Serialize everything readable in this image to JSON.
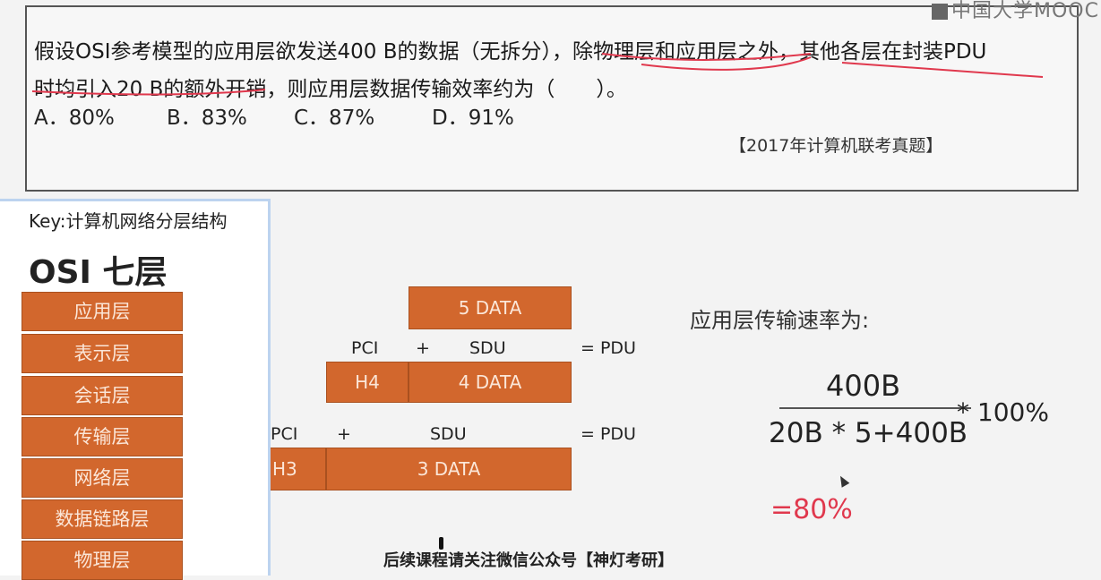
{
  "logo": {
    "text": "中国大学MOOC"
  },
  "question": {
    "line1": "假设OSI参考模型的应用层欲发送400 B的数据（无拆分），除物理层和应用层之外，其他各层在封装PDU",
    "line2": "时均引入20 B的额外开销，则应用层数据传输效率约为（　　）。",
    "options": [
      "A．80%",
      "B．83%",
      "C．87%",
      "D．91%"
    ],
    "source": "【2017年计算机联考真题】"
  },
  "sidebar": {
    "key_label": "Key:计算机网络分层结构",
    "title": "OSI 七层",
    "layers": [
      "应用层",
      "表示层",
      "会话层",
      "传输层",
      "网络层",
      "数据链路层",
      "物理层"
    ]
  },
  "diagram": {
    "row1_data": "5 DATA",
    "row2": {
      "pci": "PCI",
      "plus": "+",
      "sdu": "SDU",
      "eq": "= PDU",
      "header": "H4",
      "data": "4 DATA"
    },
    "row3": {
      "pci": "PCI",
      "plus": "+",
      "sdu": "SDU",
      "eq": "= PDU",
      "header": "H3",
      "data": "3 DATA"
    }
  },
  "calc": {
    "title": "应用层传输速率为:",
    "numerator": "400B",
    "denominator": "20B * 5+400B",
    "multiplier": "* 100%",
    "result": "=80%"
  },
  "footer": "后续课程请关注微信公众号【神灯考研】",
  "colors": {
    "layer": "#d2672d",
    "annotation": "#e0384d",
    "result": "#e0384d"
  }
}
